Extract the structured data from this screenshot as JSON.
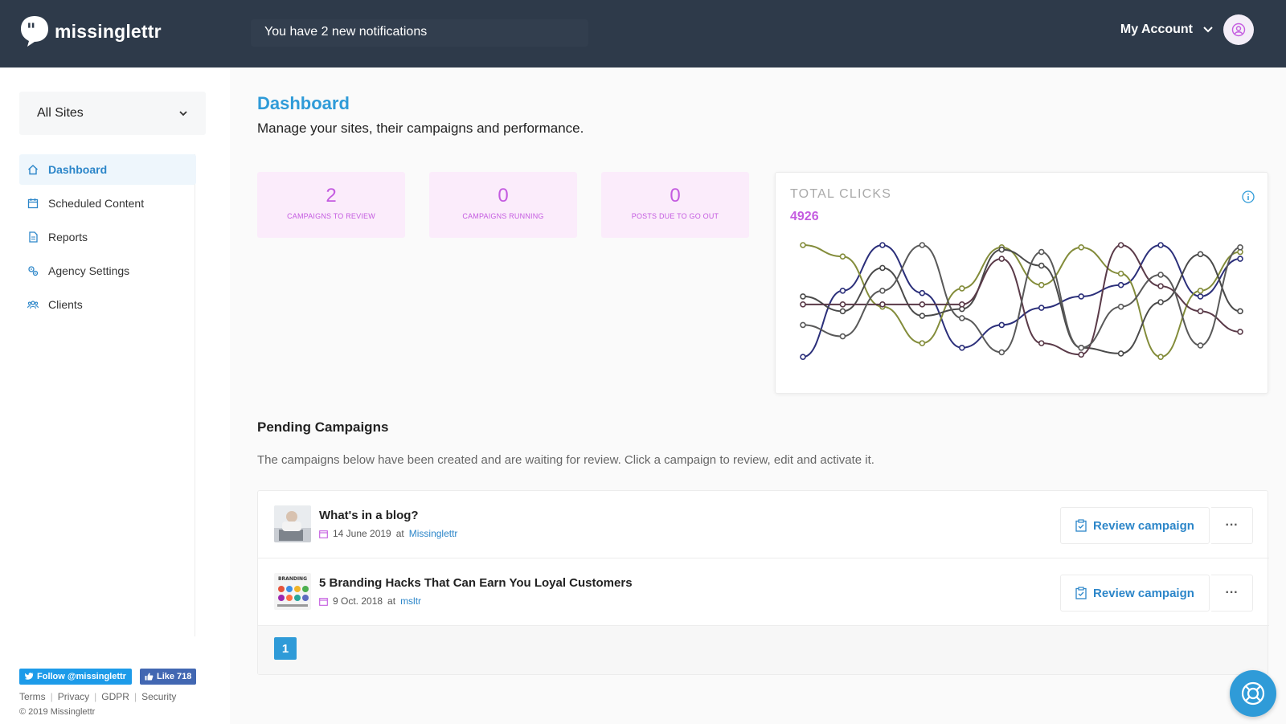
{
  "header": {
    "brand": "missinglettr",
    "notification": "You have 2 new notifications",
    "account_label": "My Account"
  },
  "sidebar": {
    "site_select": "All Sites",
    "items": [
      {
        "label": "Dashboard",
        "icon": "home-icon",
        "active": true
      },
      {
        "label": "Scheduled Content",
        "icon": "calendar-icon",
        "active": false
      },
      {
        "label": "Reports",
        "icon": "document-icon",
        "active": false
      },
      {
        "label": "Agency Settings",
        "icon": "gears-icon",
        "active": false
      },
      {
        "label": "Clients",
        "icon": "users-icon",
        "active": false
      }
    ],
    "social": {
      "twitter": "Follow @missinglettr",
      "facebook": "Like 718"
    },
    "footer_links": [
      "Terms",
      "Privacy",
      "GDPR",
      "Security"
    ],
    "copyright": "© 2019 Missinglettr"
  },
  "main": {
    "title": "Dashboard",
    "subtitle": "Manage your sites, their campaigns and performance.",
    "stats": [
      {
        "value": "2",
        "label": "CAMPAIGNS TO REVIEW"
      },
      {
        "value": "0",
        "label": "CAMPAIGNS RUNNING"
      },
      {
        "value": "0",
        "label": "POSTS DUE TO GO OUT"
      }
    ],
    "pending": {
      "title": "Pending Campaigns",
      "description": "The campaigns below have been created and are waiting for review. Click a campaign to review, edit and activate it.",
      "campaigns": [
        {
          "title": "What's in a blog?",
          "date": "14 June 2019",
          "at": "at",
          "site": "Missinglettr",
          "action": "Review campaign",
          "more": "···"
        },
        {
          "title": "5 Branding Hacks That Can Earn You Loyal Customers",
          "date": "9 Oct. 2018",
          "at": "at",
          "site": "msltr",
          "action": "Review campaign",
          "more": "···"
        }
      ],
      "current_page": "1"
    }
  },
  "colors": {
    "header_bg": "#2e3a4a",
    "accent_blue": "#2f9bd8",
    "accent_purple": "#c45be0",
    "stat_bg": "#fbecfb"
  },
  "chart_data": {
    "type": "line",
    "title": "TOTAL CLICKS",
    "total": "4926",
    "x": [
      0,
      1,
      2,
      3,
      4,
      5,
      6,
      7,
      8,
      9,
      10,
      11
    ],
    "ylim": [
      0,
      1
    ],
    "grid": false,
    "legend": "none",
    "series": [
      {
        "color": "#2b2f7a",
        "values": [
          0.02,
          0.6,
          1.0,
          0.58,
          0.1,
          0.3,
          0.45,
          0.55,
          0.65,
          1.0,
          0.55,
          0.88
        ]
      },
      {
        "color": "#838c3a",
        "values": [
          1.0,
          0.9,
          0.46,
          0.14,
          0.62,
          0.98,
          0.65,
          0.98,
          0.75,
          0.02,
          0.6,
          0.94
        ]
      },
      {
        "color": "#4a4a4a",
        "values": [
          0.55,
          0.42,
          0.8,
          0.38,
          0.44,
          0.96,
          0.82,
          0.1,
          0.05,
          0.5,
          0.92,
          0.42
        ]
      },
      {
        "color": "#5a3a48",
        "values": [
          0.48,
          0.48,
          0.48,
          0.48,
          0.48,
          0.88,
          0.14,
          0.04,
          1.0,
          0.64,
          0.42,
          0.24
        ]
      },
      {
        "color": "#595959",
        "values": [
          0.3,
          0.2,
          0.6,
          1.0,
          0.36,
          0.06,
          0.94,
          0.1,
          0.46,
          0.74,
          0.12,
          0.98
        ]
      }
    ]
  }
}
